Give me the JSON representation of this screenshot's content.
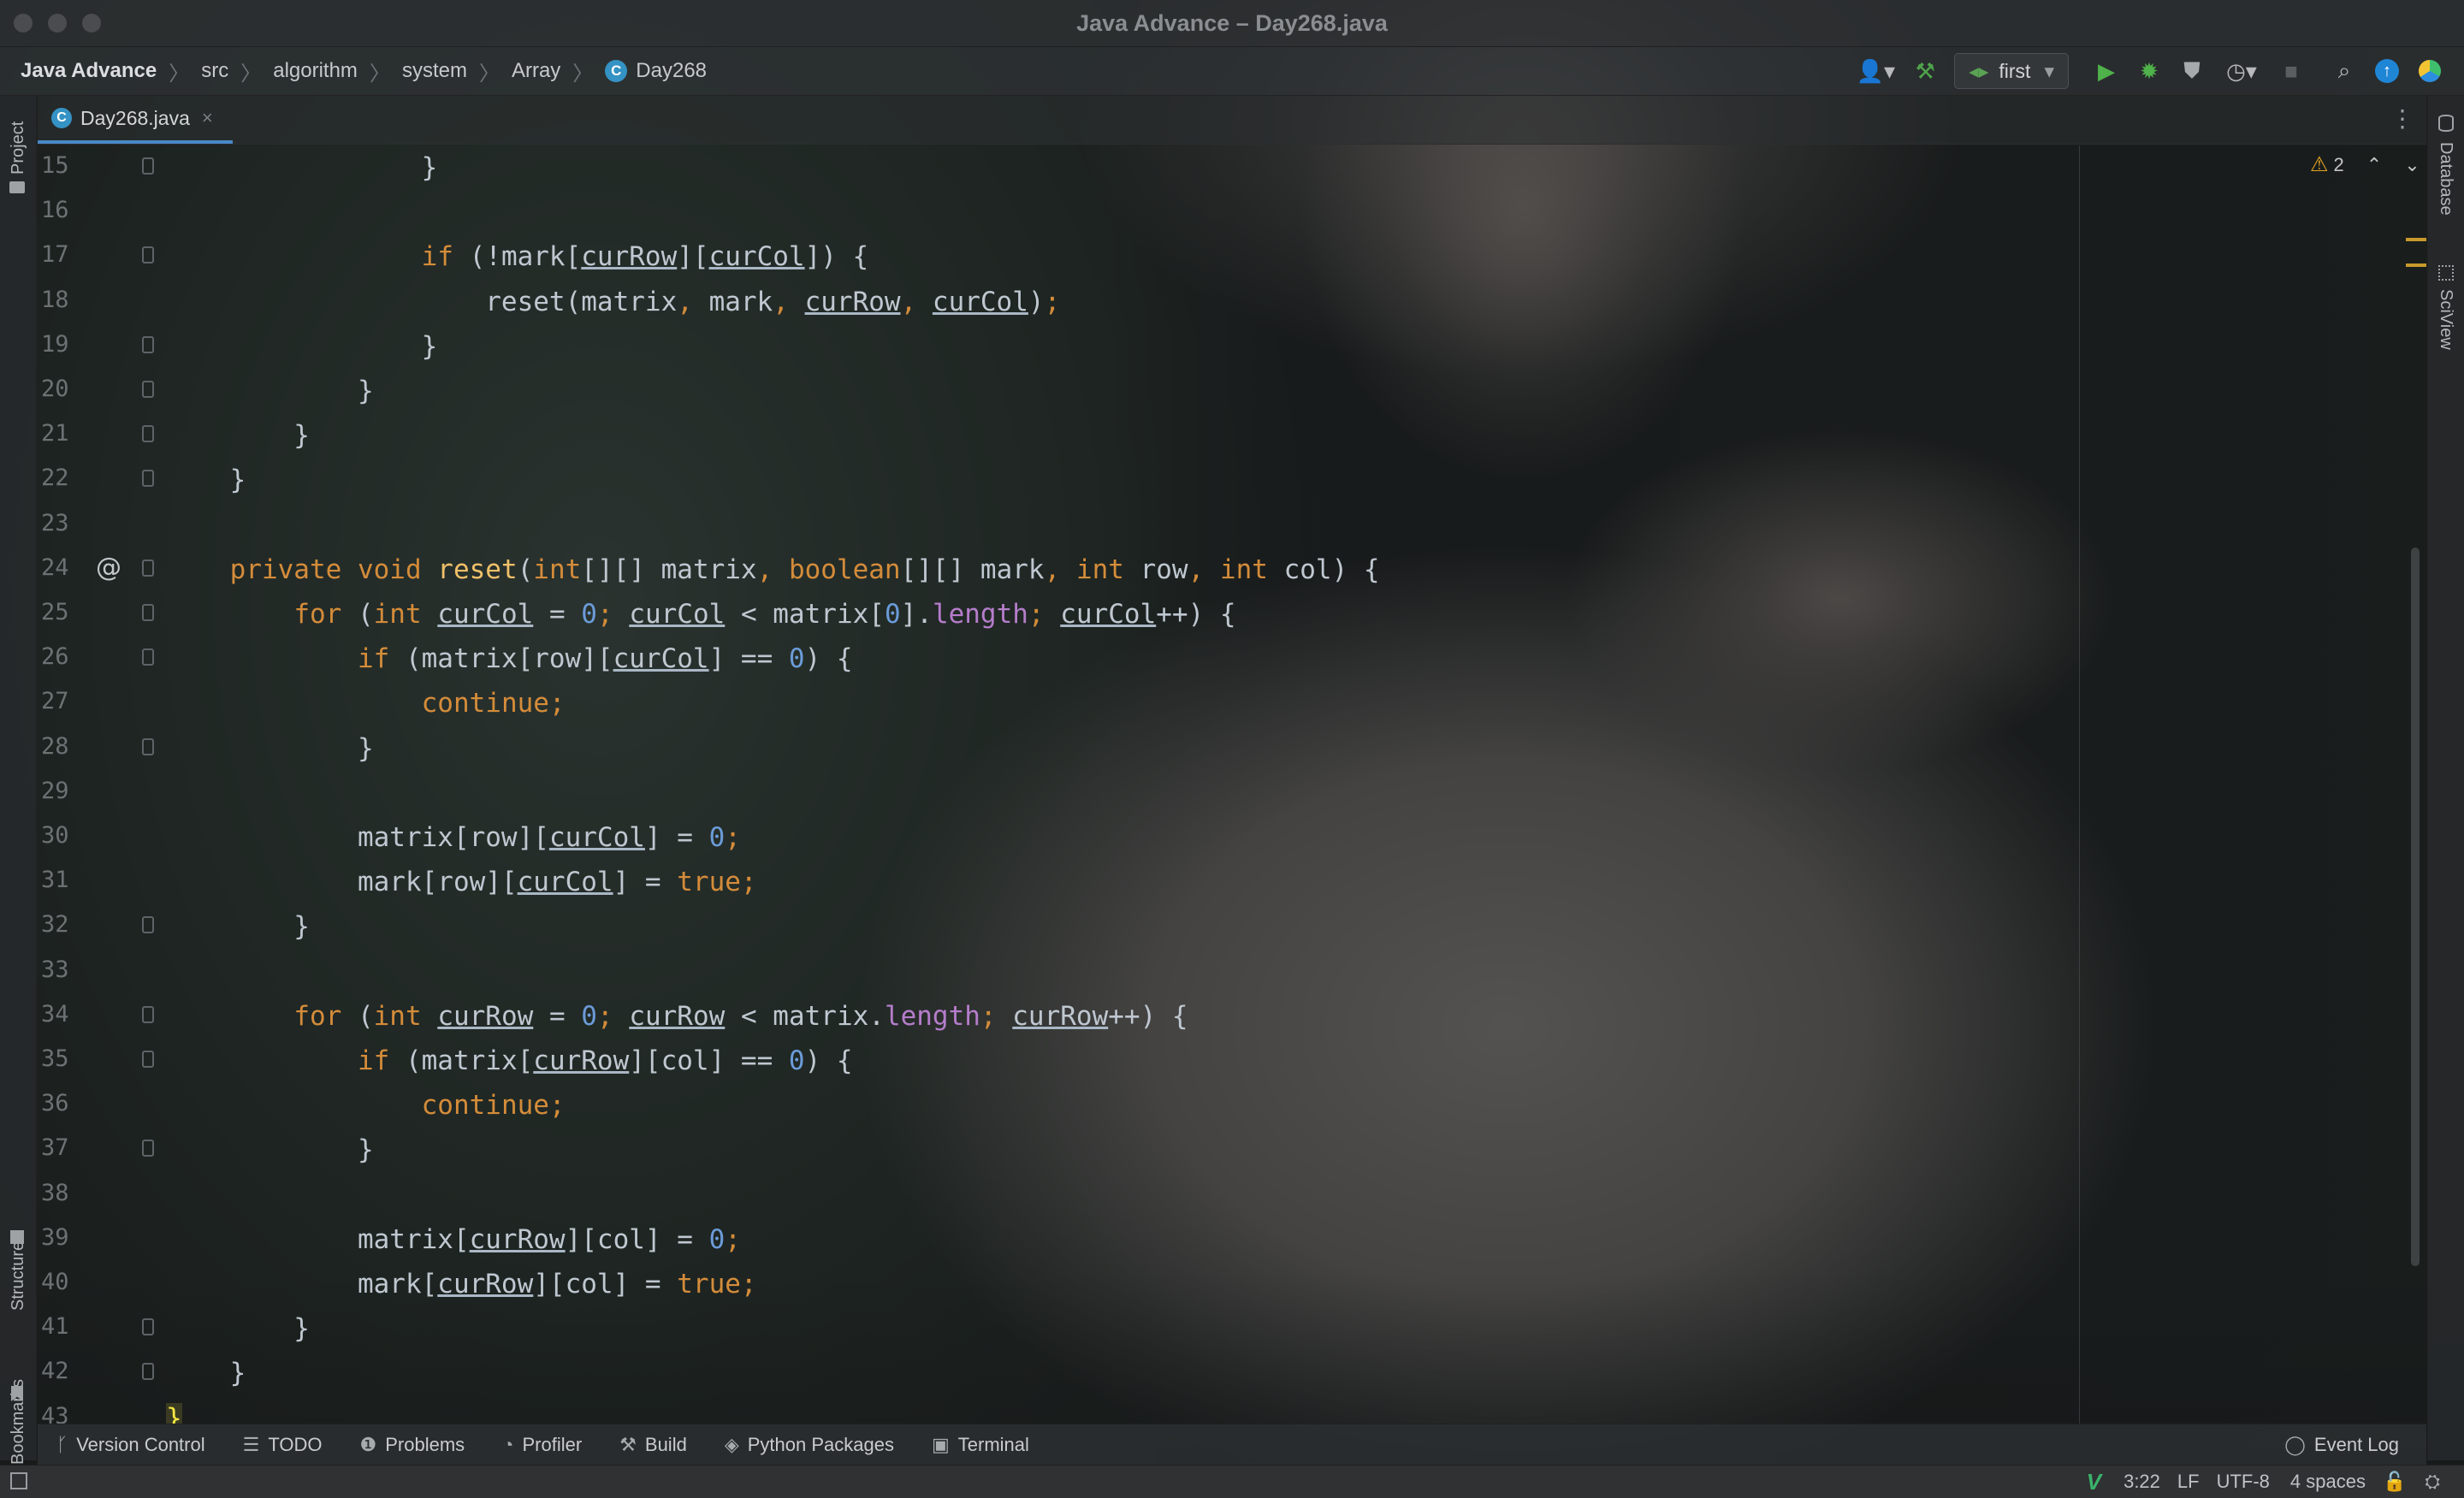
{
  "window": {
    "title": "Java Advance – Day268.java"
  },
  "breadcrumbs": [
    "Java Advance",
    "src",
    "algorithm",
    "system",
    "Array",
    "Day268"
  ],
  "breadcrumb_class_badge": "C",
  "toolbar": {
    "run_config": "first",
    "icons": [
      "user-icon",
      "build-hammer-icon",
      "run-icon",
      "debug-icon",
      "coverage-icon",
      "profile-icon",
      "stop-icon",
      "search-icon",
      "update-icon",
      "plugin-icon"
    ]
  },
  "tabs": [
    {
      "label": "Day268.java",
      "badge": "C",
      "close": "×"
    }
  ],
  "left_tools": {
    "project": "Project",
    "structure": "Structure",
    "bookmarks": "Bookmarks"
  },
  "right_tools": {
    "database": "Database",
    "sciview": "SciView"
  },
  "inspection": {
    "warnings": "2",
    "prev": "⌃",
    "next": "⌄"
  },
  "editor": {
    "lines": [
      {
        "n": "15",
        "html": "                }"
      },
      {
        "n": "16",
        "html": ""
      },
      {
        "n": "17",
        "html": "                <span class=\"kw\">if</span> (!mark[<span class=\"ul\">curRow</span>][<span class=\"ul\">curCol</span>]) {"
      },
      {
        "n": "18",
        "html": "                    reset(matrix<span class=\"kw\">,</span> mark<span class=\"kw\">,</span> <span class=\"ul\">curRow</span><span class=\"kw\">,</span> <span class=\"ul\">curCol</span>)<span class=\"kw\">;</span>"
      },
      {
        "n": "19",
        "html": "                }"
      },
      {
        "n": "20",
        "html": "            }"
      },
      {
        "n": "21",
        "html": "        }"
      },
      {
        "n": "22",
        "html": "    }"
      },
      {
        "n": "23",
        "html": ""
      },
      {
        "n": "24",
        "html": "    <span class=\"kw\">private void</span> <span class=\"fn\">reset</span>(<span class=\"kw\">int</span>[][] matrix<span class=\"kw\">,</span> <span class=\"kw\">boolean</span>[][] mark<span class=\"kw\">,</span> <span class=\"kw\">int</span> row<span class=\"kw\">,</span> <span class=\"kw\">int</span> col) {"
      },
      {
        "n": "25",
        "html": "        <span class=\"kw\">for</span> (<span class=\"kw\">int</span> <span class=\"ul\">curCol</span> = <span class=\"num\">0</span><span class=\"kw\">;</span> <span class=\"ul\">curCol</span> &lt; matrix[<span class=\"num\">0</span>].<span class=\"fld\">length</span><span class=\"kw\">;</span> <span class=\"ul\">curCol</span>++) {"
      },
      {
        "n": "26",
        "html": "            <span class=\"kw\">if</span> (matrix[row][<span class=\"ul\">curCol</span>] == <span class=\"num\">0</span>) {"
      },
      {
        "n": "27",
        "html": "                <span class=\"kw\">continue;</span>"
      },
      {
        "n": "28",
        "html": "            }"
      },
      {
        "n": "29",
        "html": ""
      },
      {
        "n": "30",
        "html": "            matrix[row][<span class=\"ul\">curCol</span>] = <span class=\"num\">0</span><span class=\"kw\">;</span>"
      },
      {
        "n": "31",
        "html": "            mark[row][<span class=\"ul\">curCol</span>] = <span class=\"kw\">true;</span>"
      },
      {
        "n": "32",
        "html": "        }"
      },
      {
        "n": "33",
        "html": ""
      },
      {
        "n": "34",
        "html": "        <span class=\"kw\">for</span> (<span class=\"kw\">int</span> <span class=\"ul\">curRow</span> = <span class=\"num\">0</span><span class=\"kw\">;</span> <span class=\"ul\">curRow</span> &lt; matrix.<span class=\"fld\">length</span><span class=\"kw\">;</span> <span class=\"ul\">curRow</span>++) {"
      },
      {
        "n": "35",
        "html": "            <span class=\"kw\">if</span> (matrix[<span class=\"ul\">curRow</span>][col] == <span class=\"num\">0</span>) {"
      },
      {
        "n": "36",
        "html": "                <span class=\"kw\">continue;</span>"
      },
      {
        "n": "37",
        "html": "            }"
      },
      {
        "n": "38",
        "html": ""
      },
      {
        "n": "39",
        "html": "            matrix[<span class=\"ul\">curRow</span>][col] = <span class=\"num\">0</span><span class=\"kw\">;</span>"
      },
      {
        "n": "40",
        "html": "            mark[<span class=\"ul\">curRow</span>][col] = <span class=\"kw\">true;</span>"
      },
      {
        "n": "41",
        "html": "        }"
      },
      {
        "n": "42",
        "html": "    }"
      },
      {
        "n": "43",
        "html": "<span class=\"cursor-brace\">}</span>"
      }
    ],
    "fold_lines": [
      "15",
      "17",
      "19",
      "20",
      "21",
      "22",
      "24",
      "25",
      "26",
      "28",
      "32",
      "34",
      "35",
      "37",
      "41",
      "42"
    ],
    "override_marker_line": "24",
    "override_marker": "@"
  },
  "bottom_tools": [
    {
      "label": "Version Control",
      "icon": "branch-icon",
      "glyph": "ᚴ"
    },
    {
      "label": "TODO",
      "icon": "list-icon",
      "glyph": "☰"
    },
    {
      "label": "Problems",
      "icon": "info-icon",
      "glyph": "❶"
    },
    {
      "label": "Profiler",
      "icon": "profiler-icon",
      "glyph": "◔"
    },
    {
      "label": "Build",
      "icon": "hammer-icon",
      "glyph": "⚒"
    },
    {
      "label": "Python Packages",
      "icon": "layers-icon",
      "glyph": "◈"
    },
    {
      "label": "Terminal",
      "icon": "terminal-icon",
      "glyph": "▣"
    }
  ],
  "event_log": "Event Log",
  "status": {
    "position": "3:22",
    "line_sep": "LF",
    "encoding": "UTF-8",
    "indent": "4 spaces"
  },
  "colors": {
    "keyword": "#d48c3a",
    "function": "#f0c069",
    "number": "#6b9bd8",
    "field": "#b57dcb",
    "accent": "#4a88c7"
  }
}
